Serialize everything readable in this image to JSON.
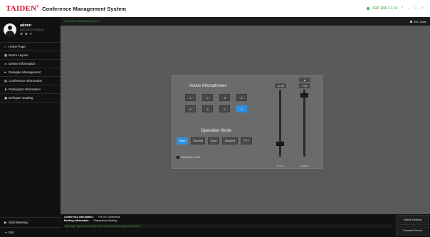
{
  "header": {
    "brand": "TAIDEN",
    "title": "Conference Management System",
    "ip": "192.168.1.174",
    "window_controls": [
      "?",
      "–",
      "□",
      "×"
    ]
  },
  "user": {
    "name": "admin",
    "datetime": "2021-06-07 15:02:15",
    "icons": [
      "gear-icon",
      "lock-icon",
      "power-icon"
    ]
  },
  "nav": [
    {
      "label": "Home Page",
      "icon": "home-icon"
    },
    {
      "label": "Room Layout",
      "icon": "layout-icon"
    },
    {
      "label": "Device Information",
      "icon": "device-icon"
    },
    {
      "label": "Delegate Management",
      "icon": "delegate-icon"
    },
    {
      "label": "Conference Information",
      "icon": "conference-icon"
    },
    {
      "label": "Participant Information",
      "icon": "participant-icon"
    },
    {
      "label": "Delegate Seating",
      "icon": "seating-icon"
    }
  ],
  "sidebar_bottom": {
    "start_meeting": "Start Meeting",
    "exit": "Exit"
  },
  "topbar": {
    "notice": "C:\\CCS\\TLCIS\\Unit(s) Found",
    "mic_state": "MIC State"
  },
  "panel": {
    "active_title": "Active Microphones",
    "mic_numbers": [
      "1",
      "2",
      "3",
      "4",
      "5",
      "6",
      "7",
      "8"
    ],
    "active_mic": "8",
    "mode_title": "Operation Mode",
    "modes": [
      "Open",
      "Override",
      "Voice",
      "Request",
      "PTT"
    ],
    "active_mode": "Open",
    "discussion_label": "Discussion Mode",
    "sliders": [
      {
        "top": "-12 dB",
        "label": "Preset 1"
      },
      {
        "top": "0 dB",
        "label": "Speaker"
      }
    ],
    "volume_up": "▲"
  },
  "status": {
    "conference_label": "Conference Information:",
    "conference_value": "The XX Conference",
    "meeting_label": "Meeting Information:",
    "meeting_value": "Preparatory Meeting",
    "green_line": "Message: System: 001 Mic(1) 001 (001) Conference(1) Present(1)"
  },
  "right_buttons": {
    "select_meeting": "Select Meeting",
    "connect_device": "Connect Device"
  },
  "colors": {
    "brand_red": "#c8102e",
    "accent_blue": "#2f8fe0",
    "status_green": "#2ea84a"
  }
}
